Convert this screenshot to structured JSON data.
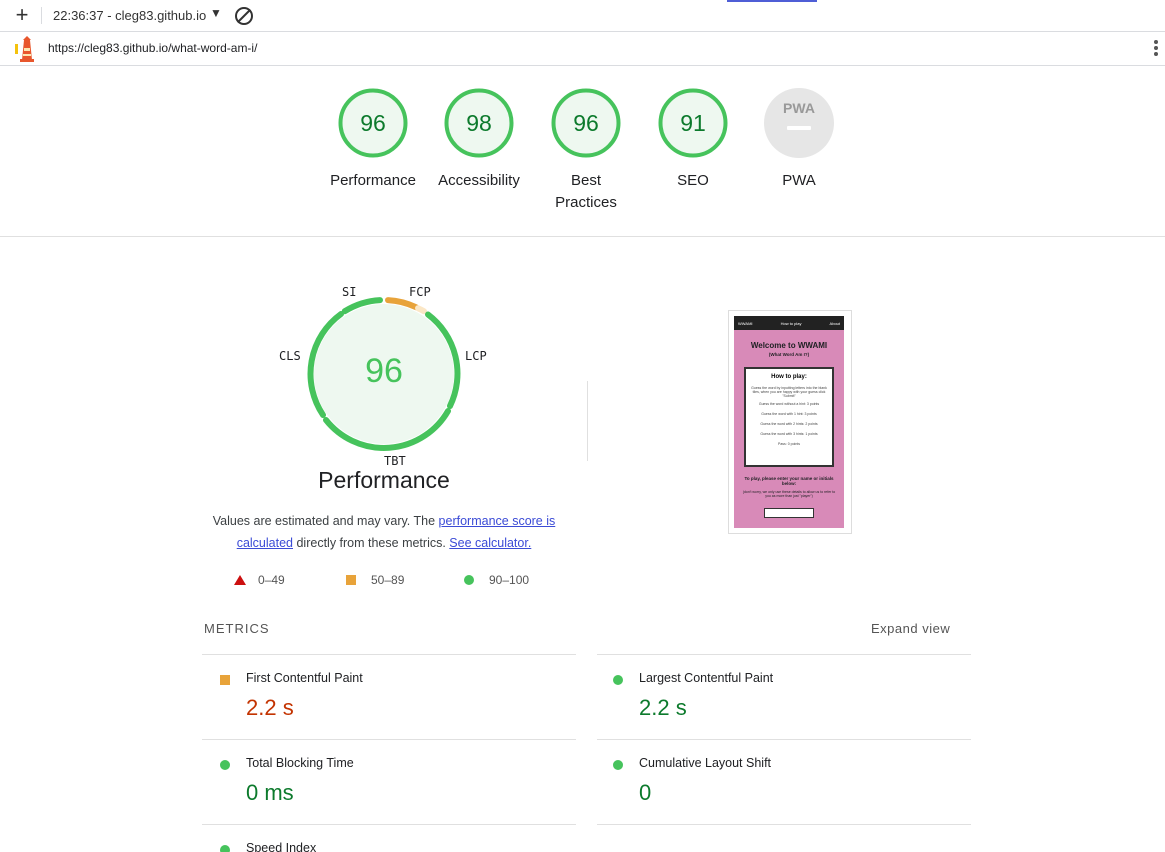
{
  "browser": {
    "session": "22:36:37 - cleg83.github.io",
    "url": "https://cleg83.github.io/what-word-am-i/"
  },
  "gauges": [
    {
      "score": "96",
      "label": "Performance"
    },
    {
      "score": "98",
      "label": "Accessibility"
    },
    {
      "score": "96",
      "label": "Best Practices"
    },
    {
      "score": "91",
      "label": "SEO"
    },
    {
      "score": "",
      "label": "PWA",
      "badge": "PWA"
    }
  ],
  "performance": {
    "score": "96",
    "title": "Performance",
    "segments": [
      "SI",
      "FCP",
      "LCP",
      "TBT",
      "CLS"
    ],
    "note_prefix": "Values are estimated and may vary. The ",
    "note_link1": "performance score is calculated",
    "note_mid": " directly from these metrics. ",
    "note_link2": "See calculator."
  },
  "legend": [
    {
      "shape": "triangle",
      "range": "0–49",
      "color": "#cc0f0f"
    },
    {
      "shape": "square",
      "range": "50–89",
      "color": "#e8a33a"
    },
    {
      "shape": "circle",
      "range": "90–100",
      "color": "#46c35c"
    }
  ],
  "metrics": {
    "heading": "METRICS",
    "expand": "Expand view",
    "items": [
      {
        "name": "First Contentful Paint",
        "value": "2.2 s",
        "status": "average"
      },
      {
        "name": "Largest Contentful Paint",
        "value": "2.2 s",
        "status": "pass"
      },
      {
        "name": "Total Blocking Time",
        "value": "0 ms",
        "status": "pass"
      },
      {
        "name": "Cumulative Layout Shift",
        "value": "0",
        "status": "pass"
      },
      {
        "name": "Speed Index",
        "value": "",
        "status": "pass"
      }
    ]
  },
  "screenshot": {
    "nav": [
      "WWAMI",
      "How to play",
      "About"
    ],
    "heading": "Welcome to WWAMI",
    "subheading": "(What Word Am I?)",
    "box_title": "How to play:",
    "box_lines": [
      "Guess the word by inputting letters into the blank tiles, when you are happy with your guess click \"Submit\"",
      "Guess the word without a hint: 3 points",
      "Guess the word with 1 hint: 3 points",
      "Guess the word with 2 hints: 2 points",
      "Guess the word with 3 hints: 1 points",
      "Pass: 0 points"
    ],
    "prompt": "To play, please enter your name or initials below:",
    "small": "(don't worry, we only use these details to allow us to refer to you as more than just \"player\")"
  },
  "colors": {
    "pass": "#0c7a2c",
    "average": "#c33300",
    "passRing": "#46c35c",
    "avgRing": "#e8a33a"
  }
}
